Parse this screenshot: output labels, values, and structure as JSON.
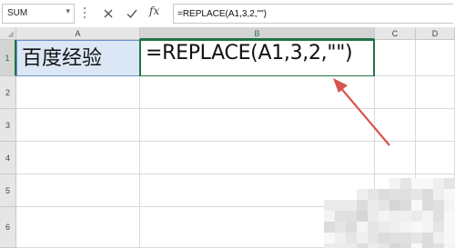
{
  "formula_bar": {
    "name_box": "SUM",
    "name_box_icon": "chevron-down-icon",
    "cancel_icon": "cancel-x-icon",
    "enter_icon": "checkmark-icon",
    "fx_label": "fx",
    "formula": "=REPLACE(A1,3,2,\"\")"
  },
  "columns": [
    "A",
    "B",
    "C",
    "D"
  ],
  "rows": [
    "1",
    "2",
    "3",
    "4",
    "5",
    "6"
  ],
  "cells": {
    "A1": "百度经验",
    "B1": "=REPLACE(A1,3,2,\"\")"
  },
  "colors": {
    "accent_green": "#217346",
    "a1_fill": "#dbe7f4",
    "arrow_red": "#d9534f"
  }
}
